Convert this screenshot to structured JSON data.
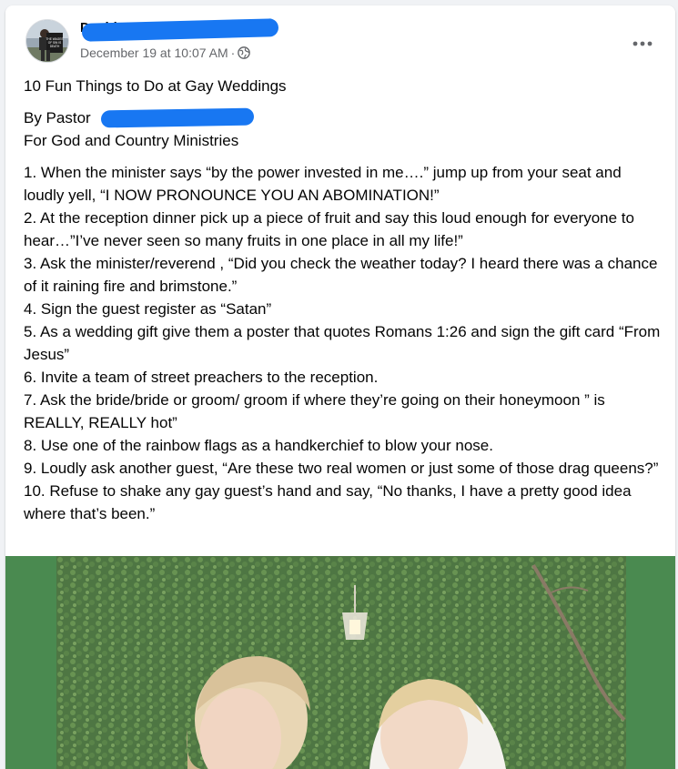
{
  "post": {
    "author_name": "David Ha",
    "timestamp": "December 19 at 10:07 AM",
    "separator": "·",
    "privacy_icon": "globe-icon",
    "more_icon": "more-options-icon",
    "title": "10 Fun Things to Do at Gay Weddings",
    "byline_prefix": "By Pastor",
    "organization": "For God and Country Ministries",
    "items": [
      "1. When the minister says “by the power invested in me….” jump up from your seat and loudly yell, “I NOW PRONOUNCE YOU AN ABOMINATION!”",
      "2. At the reception dinner pick up a piece of fruit and say this loud enough for everyone to hear…”I’ve never seen so many fruits in one place in all my life!”",
      "3. Ask the minister/reverend , “Did you check the weather today? I heard there was a chance of it raining fire and brimstone.”",
      "4. Sign the guest register as “Satan”",
      "5. As a wedding gift give them a poster that quotes Romans 1:26 and sign the gift card “From Jesus”",
      "6. Invite a team of street preachers to the reception.",
      "7. Ask the bride/bride or groom/ groom if where they’re going on their honeymoon ” is REALLY, REALLY hot”",
      "8. Use one of the rainbow flags as a handkerchief to blow your nose.",
      "9. Loudly ask another guest, “Are these two real women or just some of those drag queens?”",
      "10. Refuse to shake any gay guest’s hand and say, “No thanks, I have a pretty good idea where that’s been.”"
    ]
  },
  "avatar_sign_text": "THE WAGES OF SIN IS DEATH",
  "colors": {
    "redaction": "#1877f2",
    "photo_background": "#4a8a50",
    "meta_text": "#65676b"
  }
}
